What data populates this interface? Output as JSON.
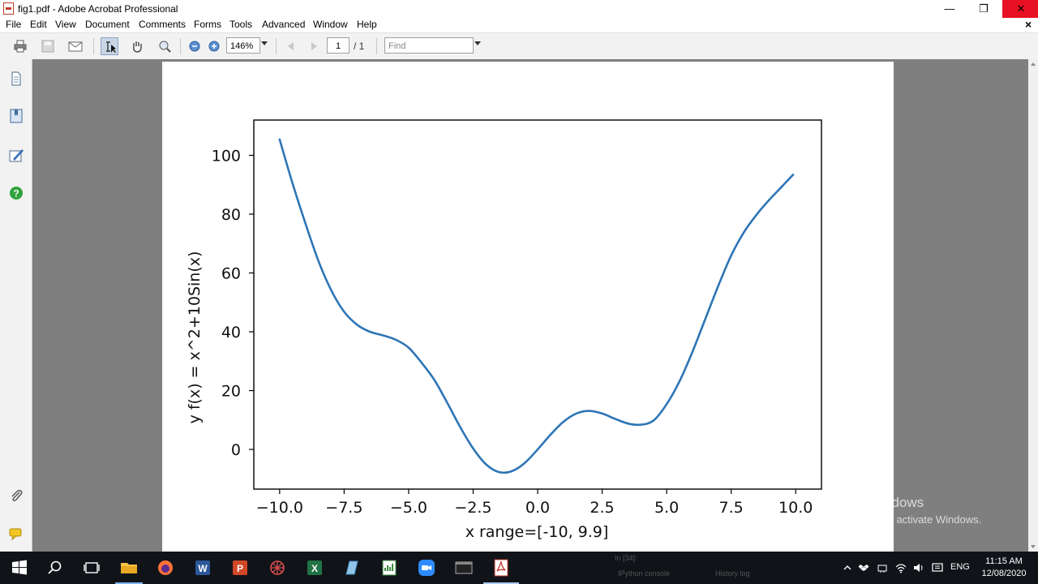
{
  "window": {
    "title": "fig1.pdf - Adobe Acrobat Professional",
    "minimize_glyph": "—",
    "restore_glyph": "❐",
    "close_glyph": "✕",
    "doc_close_glyph": "×"
  },
  "menu": {
    "items": [
      "File",
      "Edit",
      "View",
      "Document",
      "Comments",
      "Forms",
      "Tools",
      "Advanced",
      "Window",
      "Help"
    ]
  },
  "toolbar": {
    "zoom": "146%",
    "page_current": "1",
    "page_total": "/ 1",
    "find_placeholder": "Find",
    "icons": [
      "print-icon",
      "save-icon",
      "email-icon",
      "select-text-icon",
      "hand-icon",
      "zoom-tool-icon",
      "zoom-out-icon",
      "zoom-in-icon",
      "previous-page-icon",
      "next-page-icon"
    ]
  },
  "side_panel": {
    "icons": [
      "pages-icon",
      "bookmarks-icon",
      "signatures-icon",
      "help-icon",
      "attachments-icon",
      "comments-icon"
    ]
  },
  "chart_data": {
    "type": "line",
    "title": "",
    "xlabel": "x range=[-10, 9.9]",
    "ylabel": "y f(x) = x^2+10Sin(x)",
    "xlim": [
      -11,
      11
    ],
    "ylim": [
      -13.5,
      112
    ],
    "xticks": [
      -10.0,
      -7.5,
      -5.0,
      -2.5,
      0.0,
      2.5,
      5.0,
      7.5,
      10.0
    ],
    "xtick_labels": [
      "−10.0",
      "−7.5",
      "−5.0",
      "−2.5",
      "0.0",
      "2.5",
      "5.0",
      "7.5",
      "10.0"
    ],
    "yticks": [
      0,
      20,
      40,
      60,
      80,
      100
    ],
    "ytick_labels": [
      "0",
      "20",
      "40",
      "60",
      "80",
      "100"
    ],
    "grid": false,
    "line_color": "#2e75b6",
    "series": [
      {
        "x": [
          -10.0,
          -9.5,
          -9.0,
          -8.5,
          -8.0,
          -7.5,
          -7.0,
          -6.5,
          -6.0,
          -5.5,
          -5.0,
          -4.5,
          -4.0,
          -3.5,
          -3.0,
          -2.5,
          -2.0,
          -1.5,
          -1.0,
          -0.5,
          0.0,
          0.5,
          1.0,
          1.5,
          2.0,
          2.5,
          3.0,
          3.5,
          4.0,
          4.5,
          5.0,
          5.5,
          6.0,
          6.5,
          7.0,
          7.5,
          8.0,
          8.5,
          9.0,
          9.5,
          9.9
        ],
        "y": [
          105.4,
          90.5,
          76.9,
          64.2,
          54.1,
          46.8,
          42.4,
          40.0,
          38.8,
          37.3,
          34.6,
          29.5,
          23.6,
          15.8,
          7.6,
          0.3,
          -5.1,
          -7.7,
          -7.4,
          -4.6,
          0.0,
          5.0,
          9.4,
          12.2,
          13.1,
          12.2,
          10.4,
          8.8,
          8.4,
          9.9,
          15.4,
          23.2,
          33.2,
          44.4,
          55.6,
          65.9,
          73.9,
          80.0,
          85.1,
          89.7,
          93.4
        ]
      }
    ]
  },
  "watermark": {
    "line1": "Activate Windows",
    "line2": "Go to Settings to activate Windows."
  },
  "taskbar": {
    "apps": [
      "search-icon",
      "task-view-icon",
      "file-explorer-icon",
      "firefox-icon",
      "word-icon",
      "powerpoint-icon",
      "spider-app-icon",
      "excel-icon",
      "notepad-icon",
      "spreadsheet-icon",
      "zoom-icon",
      "terminal-icon",
      "acrobat-icon"
    ],
    "console_line": "In [34]:",
    "console_tab1": "IPython console",
    "console_tab2": "History log",
    "lang": "ENG",
    "time": "11:15 AM",
    "date": "12/08/2020"
  }
}
